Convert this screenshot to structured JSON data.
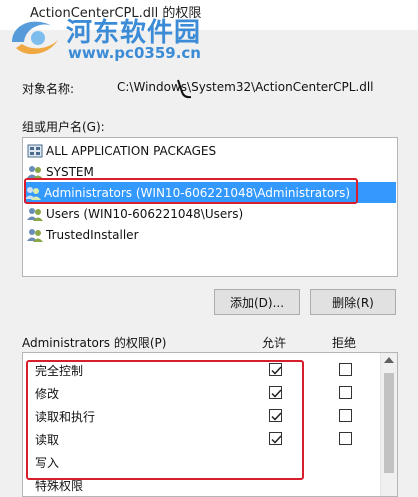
{
  "window": {
    "title": "ActionCenterCPL.dll 的权限"
  },
  "watermark": {
    "site_name": "河东软件园",
    "url": "www.pc0359.cn"
  },
  "object": {
    "label": "对象名称:",
    "value": "C:\\Windows\\System32\\ActionCenterCPL.dll"
  },
  "groups": {
    "label": "组或用户名(G):",
    "items": [
      {
        "label": "ALL APPLICATION PACKAGES",
        "icon": "packages-icon",
        "selected": false
      },
      {
        "label": "SYSTEM",
        "icon": "users-icon",
        "selected": false
      },
      {
        "label": "Administrators (WIN10-606221048\\Administrators)",
        "icon": "users-icon",
        "selected": true
      },
      {
        "label": "Users (WIN10-606221048\\Users)",
        "icon": "users-icon",
        "selected": false
      },
      {
        "label": "TrustedInstaller",
        "icon": "users-icon",
        "selected": false
      }
    ]
  },
  "buttons": {
    "add": "添加(D)...",
    "remove": "删除(R)"
  },
  "permissions": {
    "header": "Administrators 的权限(P)",
    "allow_header": "允许",
    "deny_header": "拒绝",
    "rows": [
      {
        "name": "完全控制",
        "allow": true,
        "deny": false
      },
      {
        "name": "修改",
        "allow": true,
        "deny": false
      },
      {
        "name": "读取和执行",
        "allow": true,
        "deny": false
      },
      {
        "name": "读取",
        "allow": true,
        "deny": false
      },
      {
        "name": "写入",
        "allow": false,
        "deny": false
      },
      {
        "name": "特殊权限",
        "allow": false,
        "deny": false
      }
    ]
  },
  "colors": {
    "highlight": "#d81e2c",
    "selection": "#3399ff",
    "watermark": "#3b8bd6"
  }
}
